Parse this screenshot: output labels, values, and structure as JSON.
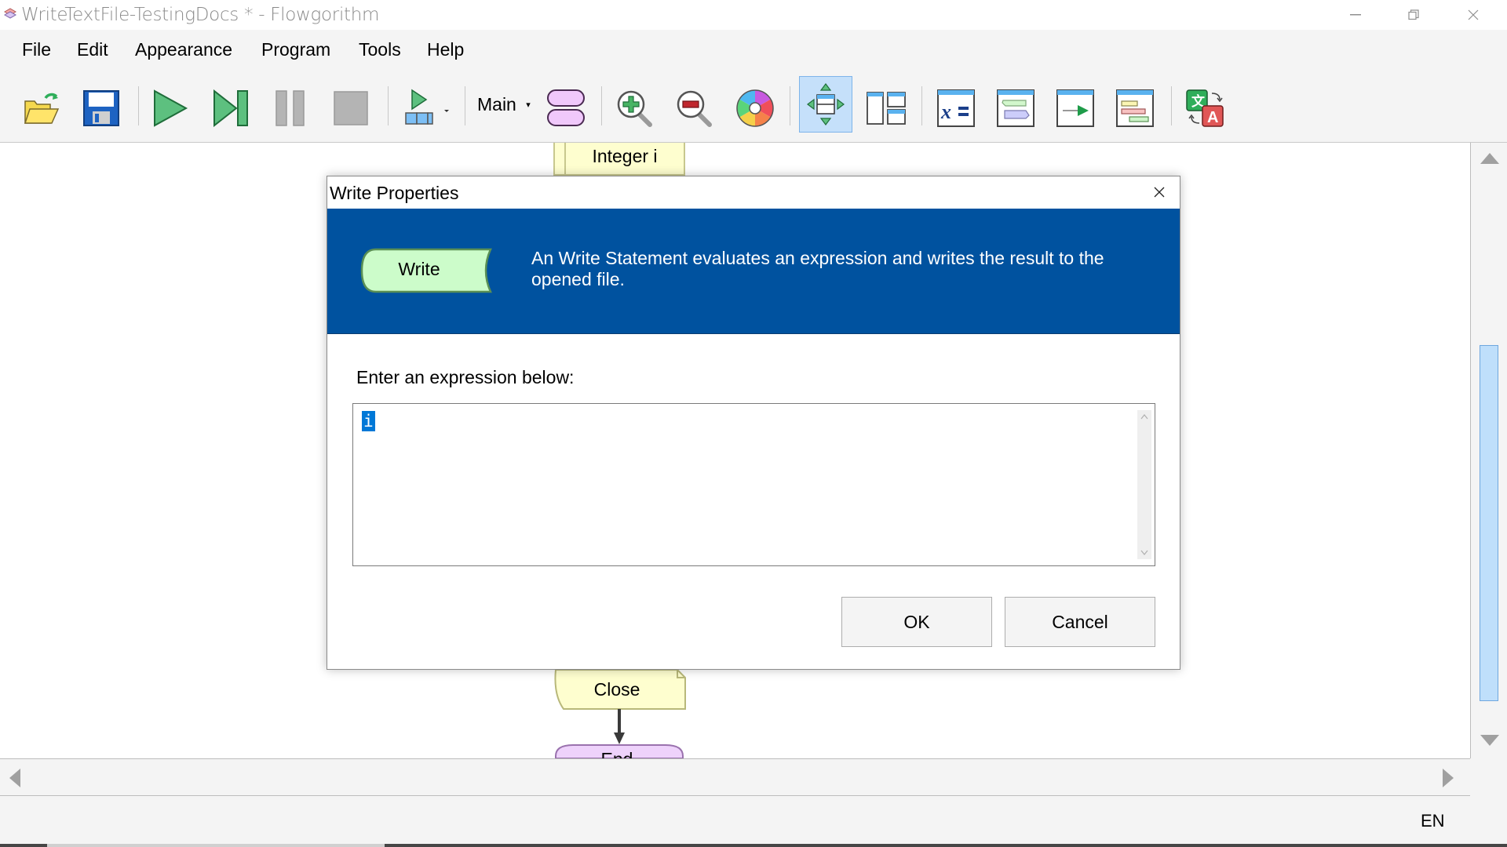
{
  "window": {
    "title": "WriteTextFile-TestingDocs * - Flowgorithm",
    "app_icon": "flowgorithm-app-icon",
    "controls": [
      "minimize",
      "restore",
      "close"
    ]
  },
  "menu": {
    "items": [
      {
        "label": "File"
      },
      {
        "label": "Edit"
      },
      {
        "label": "Appearance"
      },
      {
        "label": "Program"
      },
      {
        "label": "Tools"
      },
      {
        "label": "Help"
      }
    ]
  },
  "toolbar": {
    "buttons": [
      {
        "name": "open-icon",
        "tooltip": "Open"
      },
      {
        "name": "save-icon",
        "tooltip": "Save"
      },
      {
        "name": "run-icon",
        "tooltip": "Run"
      },
      {
        "name": "step-icon",
        "tooltip": "Step"
      },
      {
        "name": "pause-icon",
        "tooltip": "Pause"
      },
      {
        "name": "stop-icon",
        "tooltip": "Stop"
      },
      {
        "name": "run-speed-icon",
        "tooltip": "Run Speed"
      },
      {
        "name": "functions-icon",
        "tooltip": "Functions"
      },
      {
        "name": "zoom-in-icon",
        "tooltip": "Zoom In"
      },
      {
        "name": "zoom-out-icon",
        "tooltip": "Zoom Out"
      },
      {
        "name": "color-scheme-icon",
        "tooltip": "Color Scheme"
      },
      {
        "name": "layout-center-icon",
        "tooltip": "Layout",
        "active": true
      },
      {
        "name": "layout-windows-icon",
        "tooltip": "Windows"
      },
      {
        "name": "variable-watch-icon",
        "tooltip": "Variable Watch"
      },
      {
        "name": "console-icon",
        "tooltip": "Console"
      },
      {
        "name": "source-code-icon",
        "tooltip": "Source Code"
      },
      {
        "name": "chart-icon",
        "tooltip": "Chart"
      },
      {
        "name": "translate-icon",
        "tooltip": "Language"
      }
    ],
    "function_selector": "Main"
  },
  "canvas": {
    "shapes": [
      {
        "type": "declare",
        "label": "Integer i"
      },
      {
        "type": "close",
        "label": "Close"
      },
      {
        "type": "end",
        "label": "End"
      }
    ]
  },
  "dialog": {
    "title": "Write Properties",
    "shape_label": "Write",
    "description": "An Write Statement evaluates an expression and writes the result to the opened file.",
    "prompt": "Enter an expression below:",
    "expression": "i",
    "ok_label": "OK",
    "cancel_label": "Cancel",
    "header_color": "#00529f"
  },
  "status": {
    "language": "EN"
  }
}
